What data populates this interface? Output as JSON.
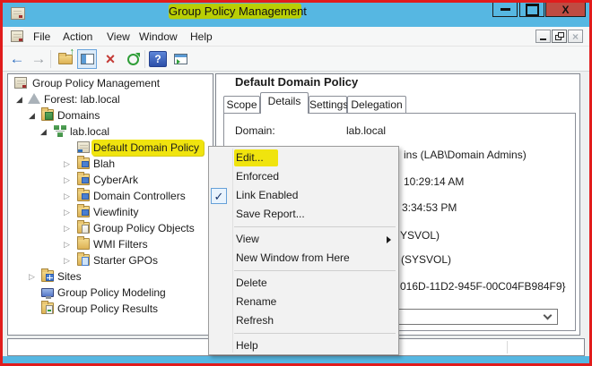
{
  "window": {
    "title": "Group Policy Management",
    "close_glyph": "X"
  },
  "menubar": {
    "items": [
      "File",
      "Action",
      "View",
      "Window",
      "Help"
    ]
  },
  "icons": {
    "expander_expanded": "◢",
    "expander_collapsed": "▷",
    "check": "✓",
    "back": "←",
    "forward": "→",
    "delete": "×",
    "help": "?",
    "up_arrow": "↑",
    "child_close": "×"
  },
  "tree": {
    "items": [
      {
        "label": "Group Policy Management",
        "level": 0,
        "state": "none",
        "icon": "gpmc-console"
      },
      {
        "label": "Forest: lab.local",
        "level": 1,
        "state": "expanded",
        "icon": "forest"
      },
      {
        "label": "Domains",
        "level": 2,
        "state": "expanded",
        "icon": "domains-folder"
      },
      {
        "label": "lab.local",
        "level": 3,
        "state": "expanded",
        "icon": "domain"
      },
      {
        "label": "Default Domain Policy",
        "level": 4,
        "state": "none",
        "icon": "gpo-link",
        "highlighted": true
      },
      {
        "label": "Blah",
        "level": 4,
        "state": "collapsed",
        "icon": "ou-folder"
      },
      {
        "label": "CyberArk",
        "level": 4,
        "state": "collapsed",
        "icon": "ou-folder"
      },
      {
        "label": "Domain Controllers",
        "level": 4,
        "state": "collapsed",
        "icon": "ou-folder"
      },
      {
        "label": "Viewfinity",
        "level": 4,
        "state": "collapsed",
        "icon": "ou-folder"
      },
      {
        "label": "Group Policy Objects",
        "level": 4,
        "state": "collapsed",
        "icon": "gpo-folder"
      },
      {
        "label": "WMI Filters",
        "level": 4,
        "state": "collapsed",
        "icon": "wmi-folder"
      },
      {
        "label": "Starter GPOs",
        "level": 4,
        "state": "collapsed",
        "icon": "starter-folder"
      },
      {
        "label": "Sites",
        "level": 2,
        "state": "collapsed",
        "icon": "sites-folder"
      },
      {
        "label": "Group Policy Modeling",
        "level": 2,
        "state": "none",
        "icon": "modeling"
      },
      {
        "label": "Group Policy Results",
        "level": 2,
        "state": "none",
        "icon": "results-folder"
      }
    ]
  },
  "content": {
    "heading": "Default Domain Policy",
    "tabs": [
      "Scope",
      "Details",
      "Settings",
      "Delegation"
    ],
    "active_tab": "Details",
    "domain_label": "Domain:",
    "domain_value": "lab.local",
    "fragments": [
      "ins (LAB\\Domain Admins)",
      "10:29:14 AM",
      "3:34:53 PM",
      "YSVOL)",
      "(SYSVOL)",
      "016D-11D2-945F-00C04FB984F9}"
    ]
  },
  "context_menu": {
    "items": [
      {
        "label": "Edit...",
        "highlighted": true
      },
      {
        "label": "Enforced"
      },
      {
        "label": "Link Enabled",
        "checked": true
      },
      {
        "label": "Save Report..."
      },
      {
        "type": "separator"
      },
      {
        "label": "View",
        "submenu": true
      },
      {
        "label": "New Window from Here"
      },
      {
        "type": "separator"
      },
      {
        "label": "Delete"
      },
      {
        "label": "Rename"
      },
      {
        "label": "Refresh"
      },
      {
        "type": "separator"
      },
      {
        "label": "Help"
      }
    ]
  },
  "colors": {
    "frame_red": "#e11c1c",
    "frame_blue": "#56b7e2",
    "highlight_yellow": "#f0e40e",
    "title_highlight": "#b9ce04",
    "close_button": "#bf4b42"
  }
}
